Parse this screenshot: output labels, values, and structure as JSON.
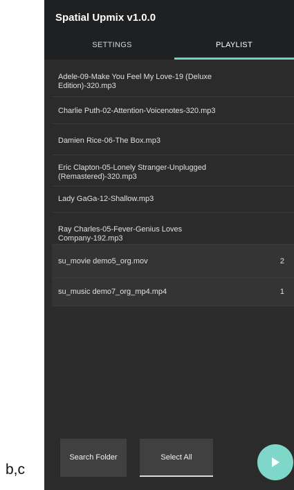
{
  "caption": "b,c",
  "app": {
    "title": "Spatial Upmix v1.0.0"
  },
  "tabs": [
    {
      "label": "SETTINGS",
      "active": false
    },
    {
      "label": "PLAYLIST",
      "active": true
    }
  ],
  "playlist": [
    {
      "name": "Adele-09-Make You Feel My Love-19 (Deluxe Edition)-320.mp3",
      "line1": "Adele-09-Make You Feel My Love-19 (Deluxe",
      "line2": "Edition)-320.mp3",
      "count": ""
    },
    {
      "name": "Charlie Puth-02-Attention-Voicenotes-320.mp3",
      "line1": "Charlie Puth-02-Attention-Voicenotes-320.mp3",
      "line2": "",
      "count": ""
    },
    {
      "name": "Damien Rice-06-The Box.mp3",
      "line1": "Damien Rice-06-The Box.mp3",
      "line2": "",
      "count": ""
    },
    {
      "name": "Eric Clapton-05-Lonely Stranger-Unplugged (Remastered)-320.mp3",
      "line1": "Eric Clapton-05-Lonely Stranger-Unplugged",
      "line2": "(Remastered)-320.mp3",
      "count": ""
    },
    {
      "name": "Lady GaGa-12-Shallow.mp3",
      "line1": "Lady GaGa-12-Shallow.mp3",
      "line2": "",
      "count": ""
    },
    {
      "name": "Ray Charles-05-Fever-Genius Loves Company-192.mp3",
      "line1": "Ray Charles-05-Fever-Genius Loves",
      "line2": "Company-192.mp3",
      "count": ""
    },
    {
      "name": "su_movie demo5_org.mov",
      "line1": "su_movie demo5_org.mov",
      "line2": "",
      "count": "2"
    },
    {
      "name": "su_music demo7_org_mp4.mp4",
      "line1": "su_music demo7_org_mp4.mp4",
      "line2": "",
      "count": "1"
    }
  ],
  "buttons": {
    "search_folder": "Search Folder",
    "select_all": "Select All"
  },
  "fab": {
    "icon": "play-icon"
  },
  "colors": {
    "accent": "#6fd3c2",
    "background": "#2b2b2b",
    "appbar": "#1f2021"
  }
}
